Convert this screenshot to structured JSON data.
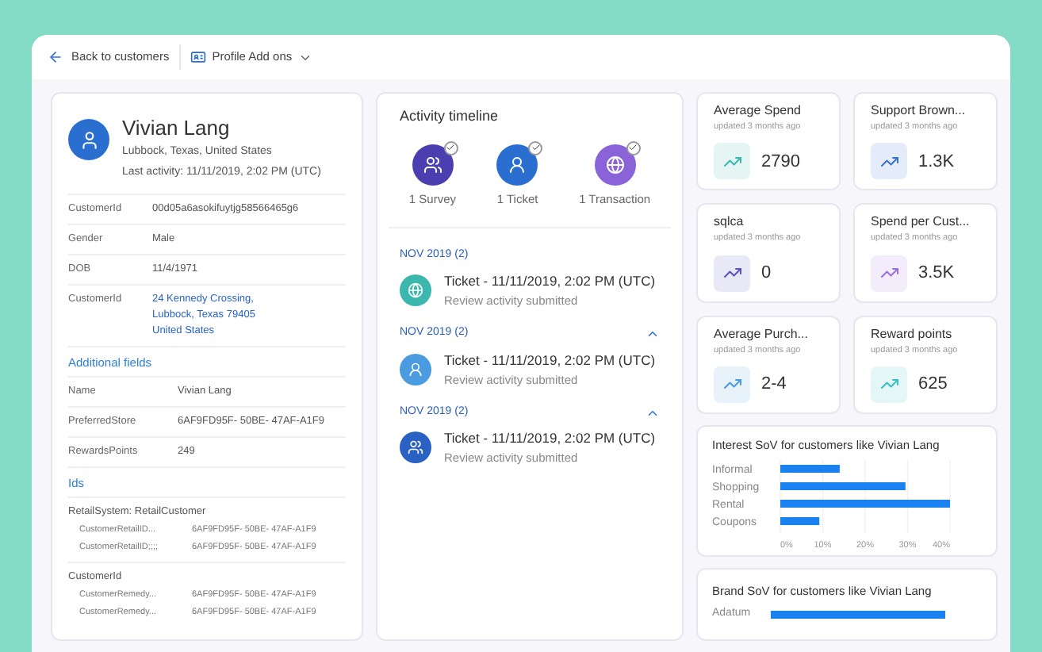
{
  "toolbar": {
    "back": "Back to customers",
    "addons": "Profile Add ons"
  },
  "profile": {
    "name": "Vivian Lang",
    "location": "Lubbock, Texas, United States",
    "last_activity": "Last activity: 11/11/2019, 2:02 PM (UTC)"
  },
  "fields": [
    {
      "label": "CustomerId",
      "kind": "text",
      "lines": [
        "00d05a6asokifuytjg58566465g6"
      ]
    },
    {
      "label": "Gender",
      "kind": "text",
      "lines": [
        "Male"
      ]
    },
    {
      "label": "DOB",
      "kind": "text",
      "lines": [
        "11/4/1971"
      ]
    },
    {
      "label": "CustomerId",
      "kind": "address",
      "lines": [
        "24 Kennedy Crossing,",
        "Lubbock, Texas 79405",
        "United States"
      ]
    }
  ],
  "additional_fields": {
    "title": "Additional fields",
    "rows": [
      {
        "label": "Name",
        "value": "Vivian Lang"
      },
      {
        "label": "PreferredStore",
        "value": "6AF9FD95F- 50BE- 47AF-A1F9"
      },
      {
        "label": "RewardsPoints",
        "value": "249"
      }
    ]
  },
  "ids": {
    "title": "Ids",
    "groups": [
      {
        "title": "RetailSystem: RetailCustomer",
        "rows": [
          {
            "label": "CustomerRetailID...",
            "value": "6AF9FD95F- 50BE- 47AF-A1F9"
          },
          {
            "label": "CustomerRetailID;;;;",
            "value": "6AF9FD95F- 50BE- 47AF-A1F9"
          }
        ]
      },
      {
        "title": "CustomerId",
        "rows": [
          {
            "label": "CustomerRemedy...",
            "value": "6AF9FD95F- 50BE- 47AF-A1F9"
          },
          {
            "label": "CustomerRemedy...",
            "value": "6AF9FD95F- 50BE- 47AF-A1F9"
          }
        ]
      }
    ]
  },
  "timeline": {
    "title": "Activity timeline",
    "summary": [
      {
        "kind": "survey",
        "label": "1 Survey",
        "color": "#4b3fb0"
      },
      {
        "kind": "ticket",
        "label": "1 Ticket",
        "color": "#2a6fcf"
      },
      {
        "kind": "transaction",
        "label": "1 Transaction",
        "color": "#8a63d8"
      }
    ],
    "groups": [
      {
        "heading": "NOV 2019 (2)",
        "expanded": false,
        "items": [
          {
            "kind": "transaction",
            "color": "#3bb7ae",
            "title": "Ticket - 11/11/2019, 2:02 PM (UTC)",
            "subtitle": "Review activity submitted"
          }
        ]
      },
      {
        "heading": "NOV 2019 (2)",
        "expanded": true,
        "items": [
          {
            "kind": "ticket",
            "color": "#4a9be0",
            "title": "Ticket - 11/11/2019, 2:02 PM (UTC)",
            "subtitle": "Review activity submitted"
          }
        ]
      },
      {
        "heading": "NOV 2019 (2)",
        "expanded": true,
        "items": [
          {
            "kind": "survey",
            "color": "#2a62c4",
            "title": "Ticket - 11/11/2019, 2:02 PM (UTC)",
            "subtitle": "Review activity submitted"
          }
        ]
      }
    ]
  },
  "kpis": [
    {
      "title": "Average Spend",
      "updated": "updated 3 months ago",
      "value": "2790",
      "color": "#3bb7ae"
    },
    {
      "title": "Support Brown...",
      "updated": "updated 3 months ago",
      "value": "1.3K",
      "color": "#3a6fd0"
    },
    {
      "title": "sqlca",
      "updated": "updated 3 months ago",
      "value": "0",
      "color": "#5b4fc4"
    },
    {
      "title": "Spend per Cust...",
      "updated": "updated 3 months ago",
      "value": "3.5K",
      "color": "#9a6fe0"
    },
    {
      "title": "Average Purch...",
      "updated": "updated 3 months ago",
      "value": "2-4",
      "color": "#4a9be0"
    },
    {
      "title": "Reward points",
      "updated": "updated 3 months ago",
      "value": "625",
      "color": "#3bbfc4"
    }
  ],
  "interest_chart": {
    "title": "Interest SoV for customers like Vivian Lang",
    "chart_data": {
      "type": "bar",
      "orientation": "horizontal",
      "categories": [
        "Informal",
        "Shopping",
        "Rental",
        "Coupons"
      ],
      "grid": true,
      "xlim": [
        0,
        40
      ],
      "series": [
        {
          "color": "#1a82f0",
          "values": [
            14,
            29.5,
            40,
            9.2
          ]
        }
      ],
      "xticks": [
        {
          "value": 0,
          "label": "0%"
        },
        {
          "value": 10,
          "label": "10%"
        },
        {
          "value": 20,
          "label": "20%"
        },
        {
          "value": 30,
          "label": "30%"
        },
        {
          "value": 40,
          "label": "40%"
        }
      ]
    }
  },
  "brand_chart": {
    "title": "Brand SoV for customers like Vivian Lang",
    "labels": [
      "Adatum"
    ]
  }
}
